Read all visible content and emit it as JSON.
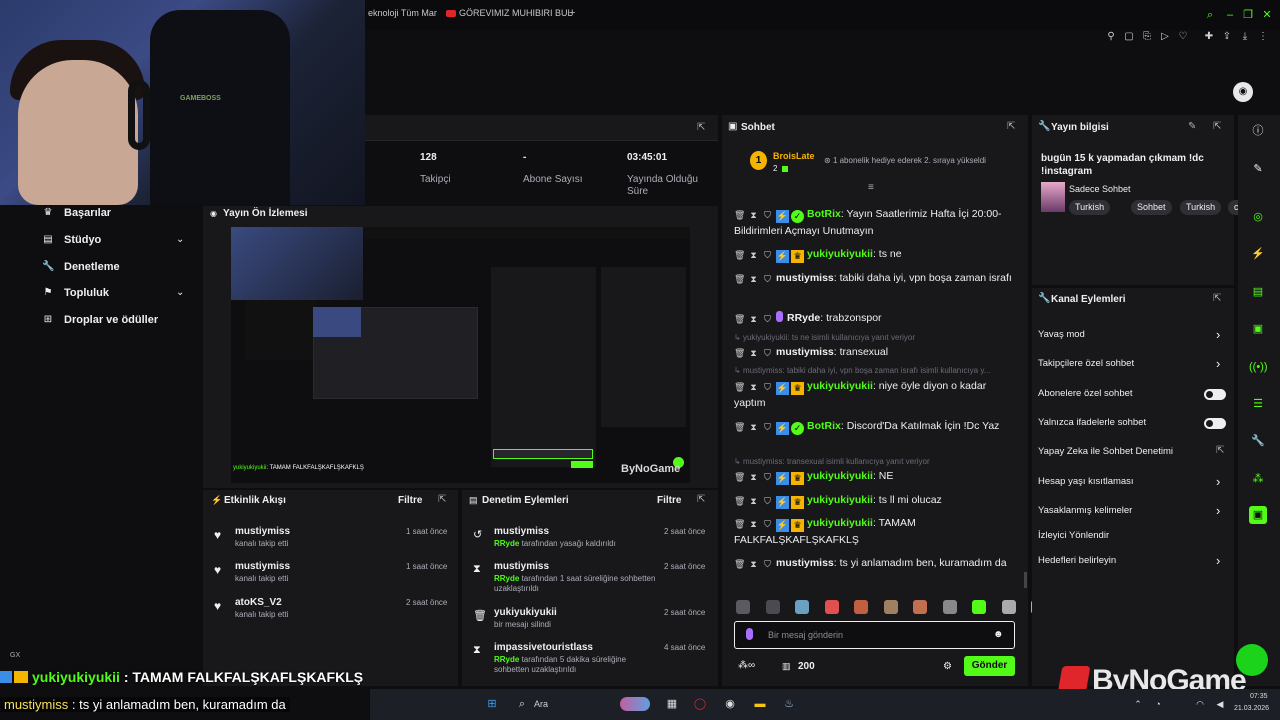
{
  "browser": {
    "tabs": [
      {
        "label": "eknoloji Tüm Mar"
      },
      {
        "label": "GÖREVIMIZ MUHIBIRI BUL"
      }
    ],
    "new_tab": "+"
  },
  "sidebar": {
    "items": [
      {
        "label": "Başarılar",
        "icon": "trophy-icon"
      },
      {
        "label": "Stüdyo",
        "icon": "studio-icon",
        "expandable": true
      },
      {
        "label": "Denetleme",
        "icon": "wrench-icon"
      },
      {
        "label": "Topluluk",
        "icon": "community-icon",
        "expandable": true
      },
      {
        "label": "Droplar ve ödüller",
        "icon": "drops-icon"
      }
    ],
    "footer": "GX"
  },
  "stats": [
    {
      "value": "128",
      "label": "Takipçi"
    },
    {
      "value": "-",
      "label": "Abone Sayısı"
    },
    {
      "value": "03:45:01",
      "label": "Yayında Olduğu Süre"
    }
  ],
  "preview": {
    "title": "Yayın Ön İzlemesi",
    "caption_user": "yukiyukiyukii",
    "caption_text": ": TAMAM FALKFALŞKAFLŞKAFKLŞ",
    "watermark": "ByNoGame"
  },
  "activity": {
    "title": "Etkinlik Akışı",
    "filter": "Filtre",
    "items": [
      {
        "name": "mustiymiss",
        "sub": "kanalı takip etti",
        "time": "1 saat önce"
      },
      {
        "name": "mustiymiss",
        "sub": "kanalı takip etti",
        "time": "1 saat önce"
      },
      {
        "name": "atoKS_V2",
        "sub": "kanalı takip etti",
        "time": "2 saat önce"
      }
    ]
  },
  "moderation": {
    "title": "Denetim Eylemleri",
    "filter": "Filtre",
    "items": [
      {
        "name": "mustiymiss",
        "by": "RRyde",
        "sub": " tarafından yasağı kaldırıldı",
        "time": "2 saat önce",
        "icon": "undo-icon"
      },
      {
        "name": "mustiymiss",
        "by": "RRyde",
        "sub": " tarafından 1 saat süreliğine sohbetten uzaklaştırıldı",
        "time": "2 saat önce",
        "icon": "hourglass-icon"
      },
      {
        "name": "yukiyukiyukii",
        "by": "",
        "sub": "bir mesajı silindi",
        "time": "2 saat önce",
        "icon": "trash-icon"
      },
      {
        "name": "impassivetouristlass",
        "by": "RRyde",
        "sub": " tarafından 5 dakika süreliğine sohbetten uzaklaştırıldı",
        "time": "4 saat önce",
        "icon": "hourglass-icon"
      }
    ]
  },
  "chat": {
    "title": "Sohbet",
    "pinned": {
      "rank": "1",
      "user": "BroisLate",
      "count": "2",
      "text": "1 abonelik hediye ederek 2. sıraya yükseldi"
    },
    "messages": [
      {
        "user": "BotRix",
        "color": "#53fc18",
        "badge": "bot",
        "text": "Yayın Saatlerimiz Hafta İçi 20:00-Bildirimleri Açmayı Unutmayın"
      },
      {
        "user": "yukiyukiyukii",
        "color": "#53fc18",
        "badge": "crown",
        "text": "ts ne"
      },
      {
        "user": "mustiymiss",
        "color": "#efeff1",
        "badge": "none",
        "text": "tabiki daha iyi, vpn boşa zaman israfı"
      },
      {
        "user": "RRyde",
        "color": "#efeff1",
        "badge": "mic",
        "text": "trabzonspor"
      },
      {
        "reply": "yukiyukiyukii: ts ne isimli kullanıcıya yanıt veriyor",
        "user": "mustiymiss",
        "color": "#efeff1",
        "badge": "none",
        "text": "transexual"
      },
      {
        "reply": "mustiymiss: tabiki daha iyi, vpn boşa zaman israfı isimli kullanıcıya y...",
        "user": "yukiyukiyukii",
        "color": "#53fc18",
        "badge": "crown",
        "text": "niye öyle diyon o kadar yaptım"
      },
      {
        "user": "BotRix",
        "color": "#53fc18",
        "badge": "bot",
        "text": "Discord'Da Katılmak İçin !Dc Yaz"
      },
      {
        "reply": "mustiymiss: transexual isimli kullanıcıya yanıt veriyor",
        "user": "yukiyukiyukii",
        "color": "#53fc18",
        "badge": "crown",
        "text": "NE"
      },
      {
        "user": "yukiyukiyukii",
        "color": "#53fc18",
        "badge": "crown",
        "text": "ts ll mi olucaz"
      },
      {
        "user": "yukiyukiyukii",
        "color": "#53fc18",
        "badge": "crown",
        "text": "TAMAM FALKFALŞKAFLŞKAFKLŞ"
      },
      {
        "user": "mustiymiss",
        "color": "#efeff1",
        "badge": "none",
        "text": "ts yi anlamadım ben, kuramadım da"
      }
    ],
    "input_placeholder": "Bir mesaj gönderin",
    "points": "200",
    "send": "Gönder"
  },
  "stream_info": {
    "title": "Yayın bilgisi",
    "stream_title": "bugün 15 k yapmadan çıkmam !dc !instagram",
    "category": "Sadece Sohbet",
    "tags": [
      "Turkish",
      "Sohbet",
      "Turkish",
      "cs"
    ]
  },
  "channel_actions": {
    "title": "Kanal Eylemleri",
    "items": [
      {
        "label": "Yavaş mod",
        "control": "chevron"
      },
      {
        "label": "Takipçilere özel sohbet",
        "control": "chevron"
      },
      {
        "label": "Abonelere özel sohbet",
        "control": "toggle"
      },
      {
        "label": "Yalnızca ifadelerle sohbet",
        "control": "toggle"
      },
      {
        "label": "Yapay Zeka ile Sohbet Denetimi",
        "control": "external"
      },
      {
        "label": "Hesap yaşı kısıtlaması",
        "control": "chevron"
      },
      {
        "label": "Yasaklanmış kelimeler",
        "control": "chevron"
      },
      {
        "label": "İzleyici Yönlendir",
        "control": "none"
      },
      {
        "label": "Hedefleri belirleyin",
        "control": "chevron"
      }
    ]
  },
  "overlay": {
    "line1_user": "yukiyukiyukii",
    "line1_text": " : TAMAM FALKFALŞKAFLŞKAFKLŞ",
    "line2_user": "mustiymiss",
    "line2_text": " : ts yi anlamadım ben, kuramadım da",
    "brand": "ByNoGame"
  },
  "taskbar": {
    "search": "Ara",
    "time": "07:35",
    "date": "21.03.2026"
  },
  "colors": {
    "accent": "#53fc18",
    "panel": "#18181b",
    "bg": "#0e0e10"
  }
}
